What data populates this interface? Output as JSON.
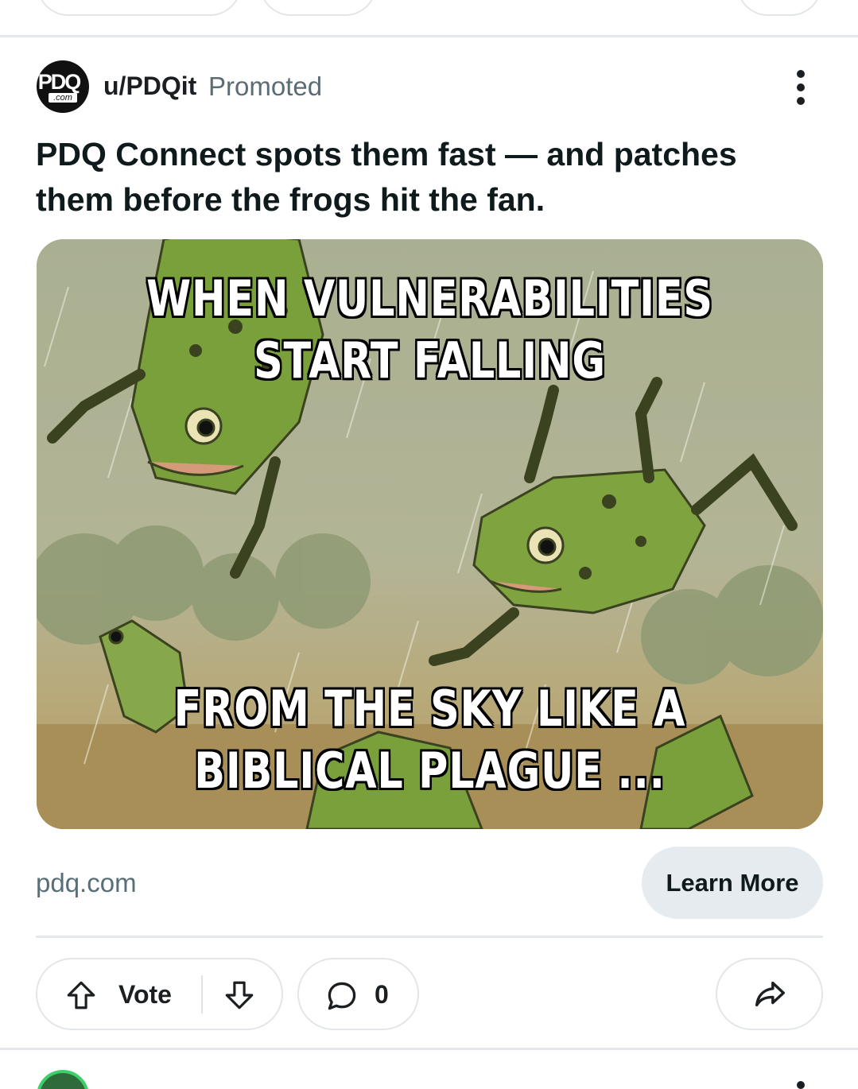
{
  "post": {
    "avatar_text": "PDQ",
    "avatar_subtext": ".com",
    "username": "u/PDQit",
    "promoted_label": "Promoted",
    "headline": "PDQ Connect spots them fast — and patches them before the frogs hit the fan.",
    "image": {
      "caption_top": "WHEN VULNERABILITIES\nSTART FALLING",
      "caption_bottom": "FROM THE SKY LIKE A\nBIBLICAL PLAGUE ...",
      "subject": "cartoon green frogs falling in rain"
    },
    "domain": "pdq.com",
    "cta_label": "Learn More"
  },
  "actions": {
    "vote_label": "Vote",
    "comment_count": "0"
  },
  "icons": [
    "more-vertical-icon",
    "upvote-icon",
    "downvote-icon",
    "comment-icon",
    "share-icon"
  ],
  "colors": {
    "cta_bg": "#e5ebee",
    "muted_text": "#576f76",
    "border": "#e2e6e8"
  }
}
